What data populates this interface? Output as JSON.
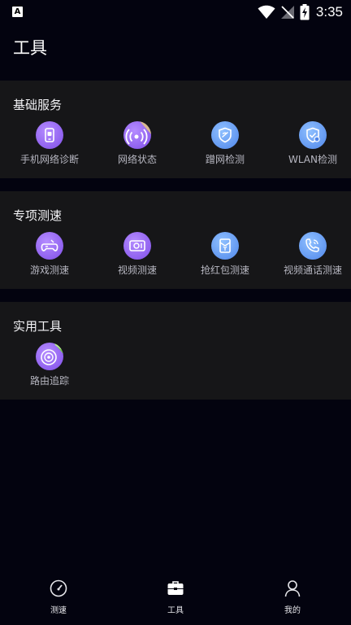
{
  "status_bar": {
    "time": "3:35"
  },
  "header": {
    "title": "工具"
  },
  "sections": [
    {
      "title": "基础服务",
      "items": [
        {
          "label": "手机网络诊断",
          "icon": "phone-network-icon"
        },
        {
          "label": "网络状态",
          "icon": "network-status-icon"
        },
        {
          "label": "蹭网检测",
          "icon": "wifi-leech-shield-icon"
        },
        {
          "label": "WLAN检测",
          "icon": "wlan-check-shield-icon"
        }
      ]
    },
    {
      "title": "专项测速",
      "items": [
        {
          "label": "游戏测速",
          "icon": "gamepad-icon"
        },
        {
          "label": "视频测速",
          "icon": "video-icon"
        },
        {
          "label": "抢红包测速",
          "icon": "red-packet-icon"
        },
        {
          "label": "视频通话测速",
          "icon": "video-call-icon"
        }
      ]
    },
    {
      "title": "实用工具",
      "items": [
        {
          "label": "路由追踪",
          "icon": "route-trace-icon"
        }
      ]
    }
  ],
  "bottom_nav": [
    {
      "label": "测速",
      "icon": "speedometer-icon"
    },
    {
      "label": "工具",
      "icon": "toolbox-icon"
    },
    {
      "label": "我的",
      "icon": "person-icon"
    }
  ],
  "colors": {
    "background": "#03030f",
    "card": "#161618",
    "purple_icon": "#9a6cf5",
    "blue_icon": "#6aa3f7"
  }
}
